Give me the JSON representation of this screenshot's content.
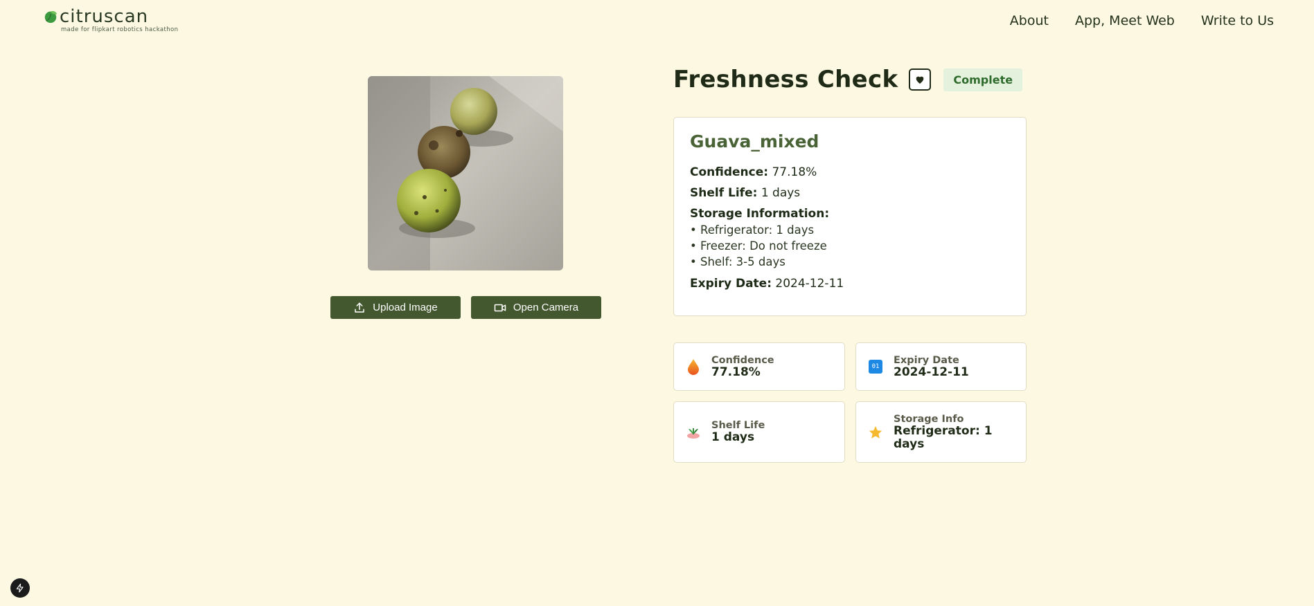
{
  "brand": {
    "name": "citruscan",
    "tagline": "made for flipkart robotics hackathon"
  },
  "nav": [
    {
      "label": "About"
    },
    {
      "label": "App, Meet Web"
    },
    {
      "label": "Write to Us"
    }
  ],
  "actions": {
    "upload_label": "Upload Image",
    "camera_label": "Open Camera"
  },
  "result": {
    "title": "Freshness Check",
    "status": "Complete",
    "fruit": "Guava_mixed",
    "confidence_label": "Confidence:",
    "confidence": "77.18%",
    "shelf_life_label": "Shelf Life:",
    "shelf_life": "1 days",
    "storage_label": "Storage Information:",
    "storage": [
      "• Refrigerator: 1 days",
      "• Freezer: Do not freeze",
      "• Shelf: 3-5 days"
    ],
    "expiry_label": "Expiry Date:",
    "expiry": "2024-12-11"
  },
  "stats": [
    {
      "label": "Confidence",
      "value": "77.18%",
      "icon": "drop-icon"
    },
    {
      "label": "Expiry Date",
      "value": "2024-12-11",
      "icon": "calendar-icon",
      "icon_text": "01"
    },
    {
      "label": "Shelf Life",
      "value": "1 days",
      "icon": "plant-icon"
    },
    {
      "label": "Storage Info",
      "value": "Refrigerator: 1 days",
      "icon": "star-icon"
    }
  ],
  "colors": {
    "background": "#fdf8e2",
    "button": "#43582f",
    "badge_bg": "#e3f1dd",
    "badge_text": "#2e6b2c",
    "accent": "#4a6336"
  }
}
